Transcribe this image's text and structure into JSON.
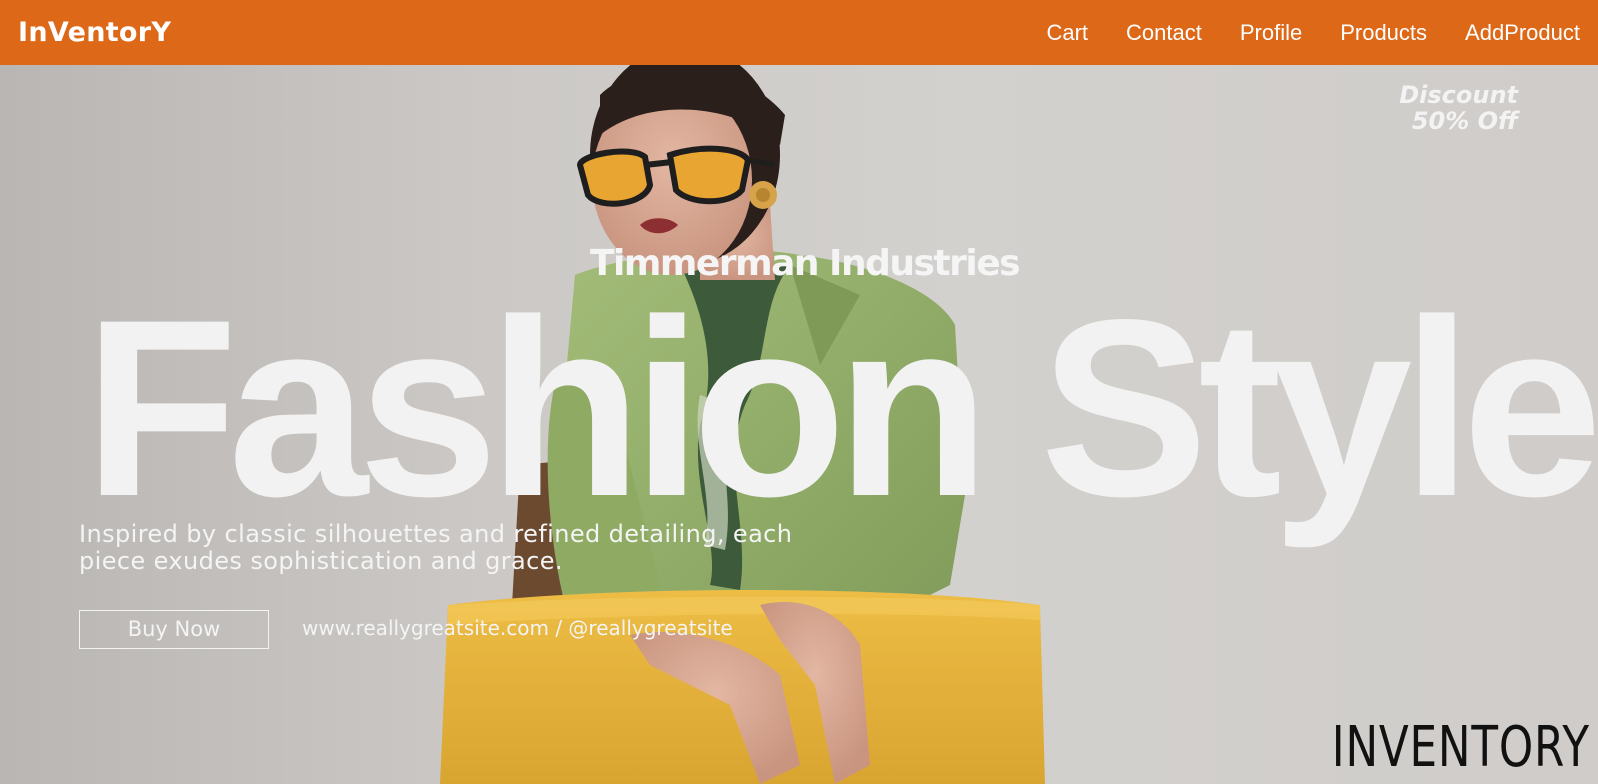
{
  "nav": {
    "brand": "InVentorY",
    "links": [
      "Cart",
      "Contact",
      "Profile",
      "Products",
      "AddProduct"
    ]
  },
  "hero": {
    "discount_line1": "Discount",
    "discount_line2": "50% Off",
    "company": "Timmerman Industries",
    "headline": "Fashion Style",
    "tagline": "Inspired by classic silhouettes and refined detailing, each piece exudes sophistication and grace.",
    "buy_button": "Buy Now",
    "site": "www.reallygreatsite.com / @reallygreatsite",
    "watermark": "INVENTORY",
    "image_description": "model in green shirt with yellow sunglasses and scarf leaning on yellow velvet chair"
  },
  "colors": {
    "nav_bg": "#dd6818",
    "nav_text": "#ffffff",
    "hero_text": "#f3f3f3",
    "shirt": "#93ad6a",
    "chair": "#e7b53a"
  }
}
